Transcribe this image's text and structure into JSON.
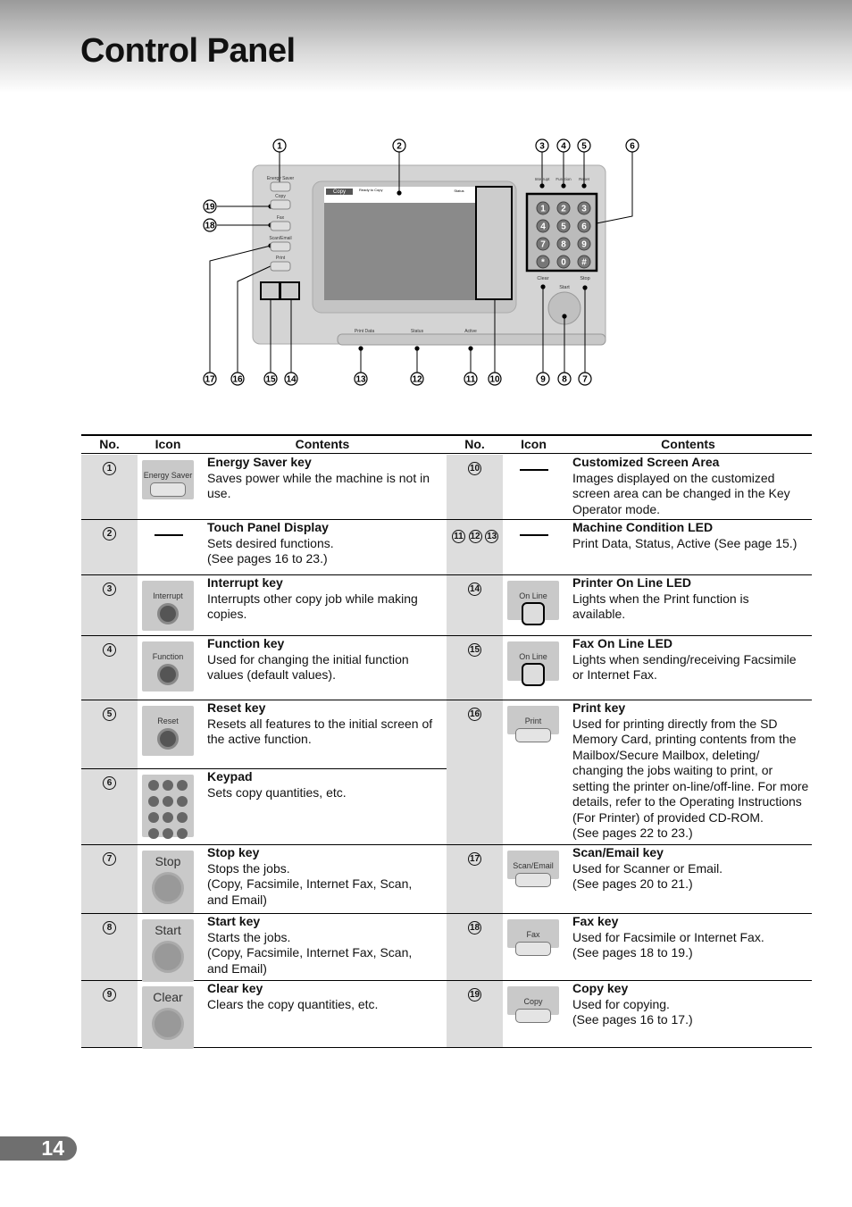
{
  "page": {
    "title": "Control Panel",
    "number": "14"
  },
  "diagram": {
    "callouts_top": [
      "1",
      "2",
      "3",
      "4",
      "5",
      "6"
    ],
    "callouts_left": [
      "19",
      "18"
    ],
    "callouts_bottom": [
      "17",
      "16",
      "15",
      "14",
      "13",
      "12",
      "11",
      "10",
      "9",
      "8",
      "7"
    ],
    "key_labels": [
      "Energy Saver",
      "Copy",
      "Fax",
      "Scan/Email",
      "Print",
      "Interrupt",
      "Function",
      "Reset",
      "Clear",
      "Start",
      "Stop"
    ],
    "screen": {
      "tab": "Copy",
      "message": "Ready to Copy",
      "status": "Status"
    },
    "led_labels": [
      "Print Data",
      "Status",
      "Active"
    ],
    "keypad": [
      "1",
      "2",
      "3",
      "4",
      "5",
      "6",
      "7",
      "8",
      "9",
      "*",
      "0",
      "#"
    ]
  },
  "table": {
    "headers": [
      "No.",
      "Icon",
      "Contents",
      "No.",
      "Icon",
      "Contents"
    ],
    "left": [
      {
        "no": [
          "1"
        ],
        "icon": "energy",
        "icon_label": "Energy Saver",
        "title": "Energy Saver key",
        "lines": [
          "Saves power while the machine is not in",
          "use."
        ]
      },
      {
        "no": [
          "2"
        ],
        "icon": "dash",
        "title": "Touch Panel Display",
        "lines": [
          "Sets desired functions.",
          "(See pages 16 to 23.)"
        ]
      },
      {
        "no": [
          "3"
        ],
        "icon": "round",
        "icon_label": "Interrupt",
        "title": "Interrupt key",
        "lines": [
          "Interrupts other copy job while making",
          "copies."
        ]
      },
      {
        "no": [
          "4"
        ],
        "icon": "round",
        "icon_label": "Function",
        "title": "Function key",
        "lines": [
          "Used for changing the initial function",
          "values (default values)."
        ]
      },
      {
        "no": [
          "5"
        ],
        "icon": "round",
        "icon_label": "Reset",
        "title": "Reset key",
        "lines": [
          "Resets all features to the initial screen of",
          "the active function."
        ]
      },
      {
        "no": [
          "6"
        ],
        "icon": "keypad",
        "title": "Keypad",
        "lines": [
          "Sets copy quantities, etc."
        ]
      },
      {
        "no": [
          "7"
        ],
        "icon": "big",
        "icon_label": "Stop",
        "title": "Stop key",
        "lines": [
          "Stops the jobs.",
          "(Copy, Facsimile, Internet Fax, Scan,",
          "and Email)"
        ]
      },
      {
        "no": [
          "8"
        ],
        "icon": "big",
        "icon_label": "Start",
        "title": "Start key",
        "lines": [
          "Starts the jobs.",
          "(Copy, Facsimile, Internet Fax, Scan,",
          "and Email)"
        ]
      },
      {
        "no": [
          "9"
        ],
        "icon": "big",
        "icon_label": "Clear",
        "title": "Clear key",
        "lines": [
          "Clears the copy quantities, etc."
        ]
      }
    ],
    "right": [
      {
        "no": [
          "10"
        ],
        "icon": "dash",
        "title": "Customized Screen Area",
        "lines": [
          "Images displayed on the customized",
          "screen area can be changed in the Key",
          "Operator mode."
        ]
      },
      {
        "no": [
          "11",
          "12",
          "13"
        ],
        "icon": "dash",
        "title": "Machine Condition LED",
        "lines": [
          "Print Data, Status, Active (See page 15.)"
        ]
      },
      {
        "no": [
          "14"
        ],
        "icon": "led",
        "icon_label": "On Line",
        "title": "Printer On Line LED",
        "lines": [
          "Lights when the Print function is",
          "available."
        ]
      },
      {
        "no": [
          "15"
        ],
        "icon": "led",
        "icon_label": "On Line",
        "title": "Fax On Line LED",
        "lines": [
          "Lights when sending/receiving Facsimile",
          "or Internet Fax."
        ]
      },
      {
        "no": [
          "16"
        ],
        "icon": "rect",
        "icon_label": "Print",
        "title": "Print key",
        "lines": [
          "Used for printing directly from the SD",
          "Memory Card, printing contents from the",
          "Mailbox/Secure Mailbox, deleting/",
          "changing the jobs waiting to print, or",
          "setting the printer on-line/off-line. For more",
          "details, refer to the Operating Instructions",
          "(For Printer) of provided CD-ROM.",
          "(See pages 22 to 23.)"
        ]
      },
      {
        "no": [
          "17"
        ],
        "icon": "rect",
        "icon_label": "Scan/Email",
        "title": "Scan/Email key",
        "lines": [
          "Used for Scanner or Email.",
          "(See pages 20 to 21.)"
        ]
      },
      {
        "no": [
          "18"
        ],
        "icon": "rect",
        "icon_label": "Fax",
        "title": "Fax key",
        "lines": [
          "Used for Facsimile or Internet Fax.",
          "(See pages 18 to 19.)"
        ]
      },
      {
        "no": [
          "19"
        ],
        "icon": "rect",
        "icon_label": "Copy",
        "title": "Copy key",
        "lines": [
          "Used for copying.",
          "(See pages 16 to 17.)"
        ]
      }
    ]
  }
}
